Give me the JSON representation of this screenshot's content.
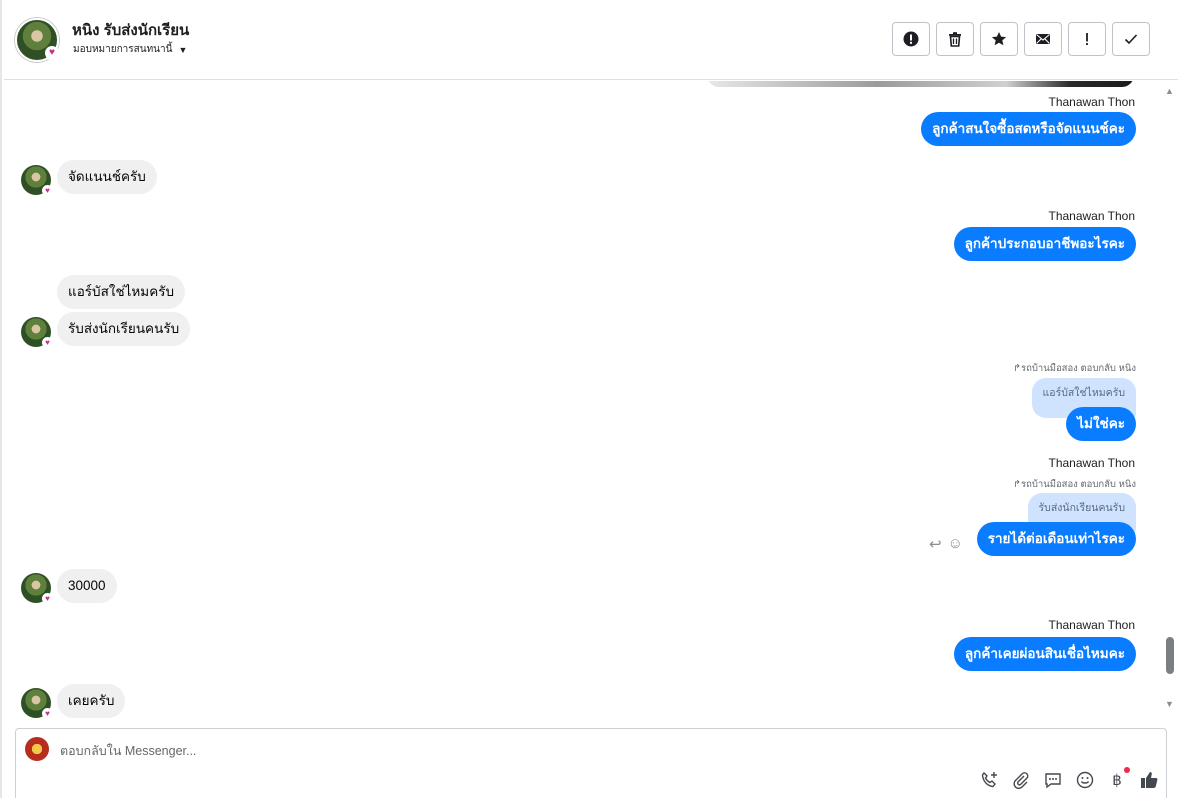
{
  "header": {
    "contact_name": "หนิง รับส่งนักเรียน",
    "assign_label": "มอบหมายการสนทนานี้",
    "actions": [
      {
        "icon": "alert-circle-icon",
        "label": "!"
      },
      {
        "icon": "trash-icon"
      },
      {
        "icon": "star-icon"
      },
      {
        "icon": "envelope-icon"
      },
      {
        "icon": "exclamation-icon",
        "label": "!"
      },
      {
        "icon": "check-icon",
        "label": "✓"
      }
    ]
  },
  "messages": [
    {
      "dir": "out",
      "sender": "Thanawan Thon",
      "text": "ลูกค้าสนใจซื้อสดหรือจัดแนนช์คะ"
    },
    {
      "dir": "in",
      "text": "จัดแนนช์ครับ"
    },
    {
      "dir": "out",
      "sender": "Thanawan Thon",
      "text": "ลูกค้าประกอบอาชีพอะไรคะ"
    },
    {
      "dir": "in",
      "text": "แอร์บัสใช่ไหมครับ"
    },
    {
      "dir": "in",
      "text": "รับส่งนักเรียนคนรับ"
    },
    {
      "dir": "out",
      "reply_note": "รถบ้านมือสอง ตอบกลับ หนิง",
      "quoted": "แอร์บัสใช่ไหมครับ",
      "text": "ไม่ใช่คะ"
    },
    {
      "dir": "out",
      "sender": "Thanawan Thon",
      "reply_note": "รถบ้านมือสอง ตอบกลับ หนิง",
      "quoted": "รับส่งนักเรียนคนรับ",
      "text": "รายได้ต่อเดือนเท่าไรคะ"
    },
    {
      "dir": "in",
      "text": "30000"
    },
    {
      "dir": "out",
      "sender": "Thanawan Thon",
      "text": "ลูกค้าเคยผ่อนสินเชื่อไหมคะ"
    },
    {
      "dir": "in",
      "text": "เคยครับ"
    }
  ],
  "composer": {
    "placeholder": "ตอบกลับใน Messenger...",
    "icons": [
      "call-add-icon",
      "attachment-icon",
      "saved-reply-icon",
      "emoji-icon",
      "baht-payment-icon",
      "thumbs-up-icon"
    ]
  },
  "colors": {
    "outgoing_bubble": "#0a7cff",
    "incoming_bubble": "#f0f0f0",
    "quoted_bubble": "#cfe3ff",
    "notification_dot": "#f02849"
  }
}
